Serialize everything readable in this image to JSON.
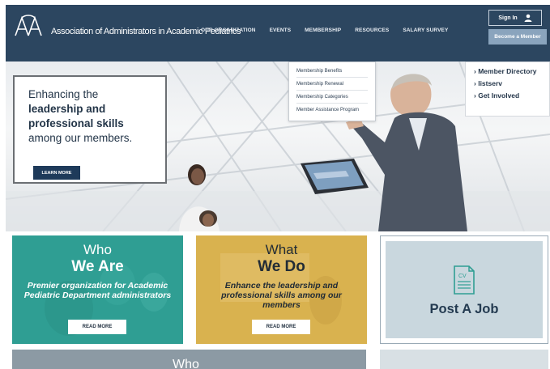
{
  "header": {
    "logo_text": "AAPA",
    "site_name": "Association of Administrators in Academic Pediatrics",
    "nav": [
      "OUR ORGANIZATION",
      "EVENTS",
      "MEMBERSHIP",
      "RESOURCES",
      "SALARY SURVEY"
    ],
    "signin_label": "Sign In",
    "become_member_label": "Become a Member"
  },
  "dropdown": {
    "items": [
      "Membership Benefits",
      "Membership Renewal",
      "Membership Categories",
      "Member Assistance Program"
    ]
  },
  "submenu": {
    "items": [
      "Member Directory",
      "listserv",
      "Get Involved"
    ]
  },
  "hero": {
    "line1": "Enhancing the",
    "line2": "leadership and",
    "line3": "professional skills",
    "line4": "among our members.",
    "button": "LEARN MORE"
  },
  "cards": {
    "who": {
      "title1": "Who",
      "title2": "We Are",
      "desc": "Premier organization for Academic Pediatric Department administrators",
      "button": "READ MORE"
    },
    "what": {
      "title1": "What",
      "title2": "We Do",
      "desc": "Enhance the leadership and professional skills among our members",
      "button": "READ MORE"
    },
    "job": {
      "icon_label": "CV",
      "title": "Post A Job"
    }
  },
  "row2": {
    "partial_title": "Who"
  },
  "colors": {
    "header_bg": "#2c4660",
    "teal": "#2f9e93",
    "gold": "#d9b24f",
    "job_bg": "#c9d7de"
  }
}
